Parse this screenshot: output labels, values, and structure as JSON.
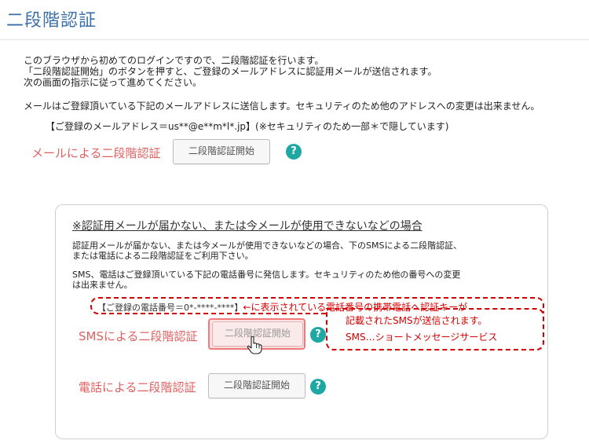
{
  "page": {
    "title": "二段階認証"
  },
  "intro": {
    "line1": "このブラウザから初めてのログインですので、二段階認証を行います。",
    "line2": "「二段階認証開始」のボタンを押すと、ご登録のメールアドレスに認証用メールが送信されます。",
    "line3": "次の画面の指示に従って進めてください。",
    "email_notice": "メールはご登録頂いている下記のメールアドレスに送信します。セキュリティのため他のアドレスへの変更は出来ません。",
    "registered_email": "【ご登録のメールアドレス＝us**@e**m*l*.jp】(※セキュリティのため一部＊で隠しています)"
  },
  "email_method": {
    "label": "メールによる二段階認証",
    "button": "二段階認証開始",
    "help": "?"
  },
  "alt_panel": {
    "heading": "※認証用メールが届かない、または今メールが使用できないなどの場合",
    "desc_line1": "認証用メールが届かない、または今メールが使用できないなどの場合、下のSMSによる二段階認証、",
    "desc_line2": "または電話による二段階認証をご利用下さい。",
    "phone_notice_line1": "SMS、電話はご登録頂いている下記の電話番号に発信します。セキュリティのため他の番号への変更",
    "phone_notice_line2": "は出来ません。",
    "registered_phone": "【ご登録の電話番号＝0*-****-****】",
    "annotation_arrow": "←に表示されている電話番号の携帯電話へ認証キーが",
    "annotation_line2": "記載されたSMSが送信されます。",
    "annotation_line3": "SMS…ショートメッセージサービス",
    "sms": {
      "label": "SMSによる二段階認証",
      "button": "二段階認証開始",
      "help": "?"
    },
    "phone": {
      "label": "電話による二段階認証",
      "button": "二段階認証開始",
      "help": "?"
    }
  },
  "colors": {
    "title": "#3a6ea8",
    "method_label": "#e06060",
    "help_icon": "#1ea7a3",
    "annotation": "#d40000"
  }
}
